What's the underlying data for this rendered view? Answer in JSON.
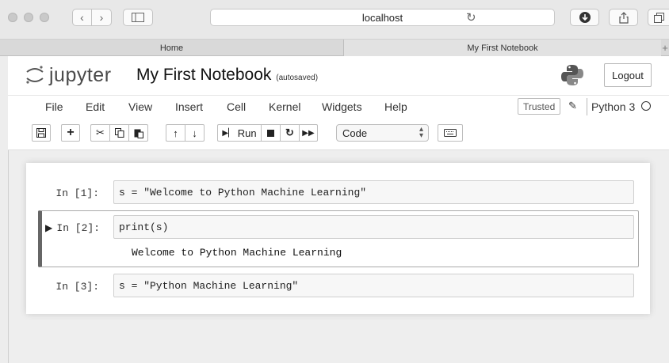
{
  "browser": {
    "url": "localhost",
    "tabs": [
      {
        "label": "Home"
      },
      {
        "label": "My First Notebook"
      }
    ],
    "new_tab_label": "+"
  },
  "header": {
    "logo_text": "jupyter",
    "notebook_title": "My First Notebook",
    "autosave_status": "(autosaved)",
    "logout_label": "Logout"
  },
  "menubar": {
    "items": [
      "File",
      "Edit",
      "View",
      "Insert",
      "Cell",
      "Kernel",
      "Widgets",
      "Help"
    ],
    "trusted_label": "Trusted",
    "kernel_name": "Python 3"
  },
  "toolbar": {
    "run_label": "Run",
    "cell_type": "Code"
  },
  "cells": [
    {
      "prompt": "In [1]:",
      "input": "s = \"Welcome to Python Machine Learning\""
    },
    {
      "prompt": "In [2]:",
      "input": "print(s)",
      "output": "Welcome to Python Machine Learning"
    },
    {
      "prompt": "In [3]:",
      "input": "s = \"Python Machine Learning\""
    }
  ]
}
